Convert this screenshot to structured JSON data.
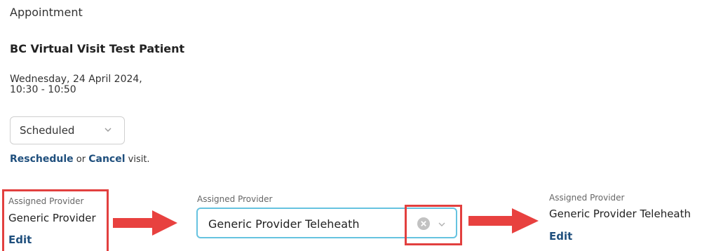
{
  "header": {
    "title": "Appointment"
  },
  "appointment": {
    "patient_name": "BC Virtual Visit Test Patient",
    "date": "Wednesday, 24 April 2024,",
    "time": "10:30 - 10:50",
    "status": "Scheduled"
  },
  "actions": {
    "reschedule": "Reschedule",
    "or": " or ",
    "cancel": "Cancel",
    "suffix": " visit."
  },
  "provider_before": {
    "label": "Assigned Provider",
    "name": "Generic Provider",
    "edit": "Edit"
  },
  "provider_editing": {
    "label": "Assigned Provider",
    "value": "Generic Provider Teleheath"
  },
  "provider_after": {
    "label": "Assigned Provider",
    "name": "Generic Provider Teleheath",
    "edit": "Edit"
  },
  "colors": {
    "link": "#1f4f7d",
    "highlight": "#e2403f",
    "input_focus": "#66c3e0",
    "arrow": "#e8413f"
  }
}
